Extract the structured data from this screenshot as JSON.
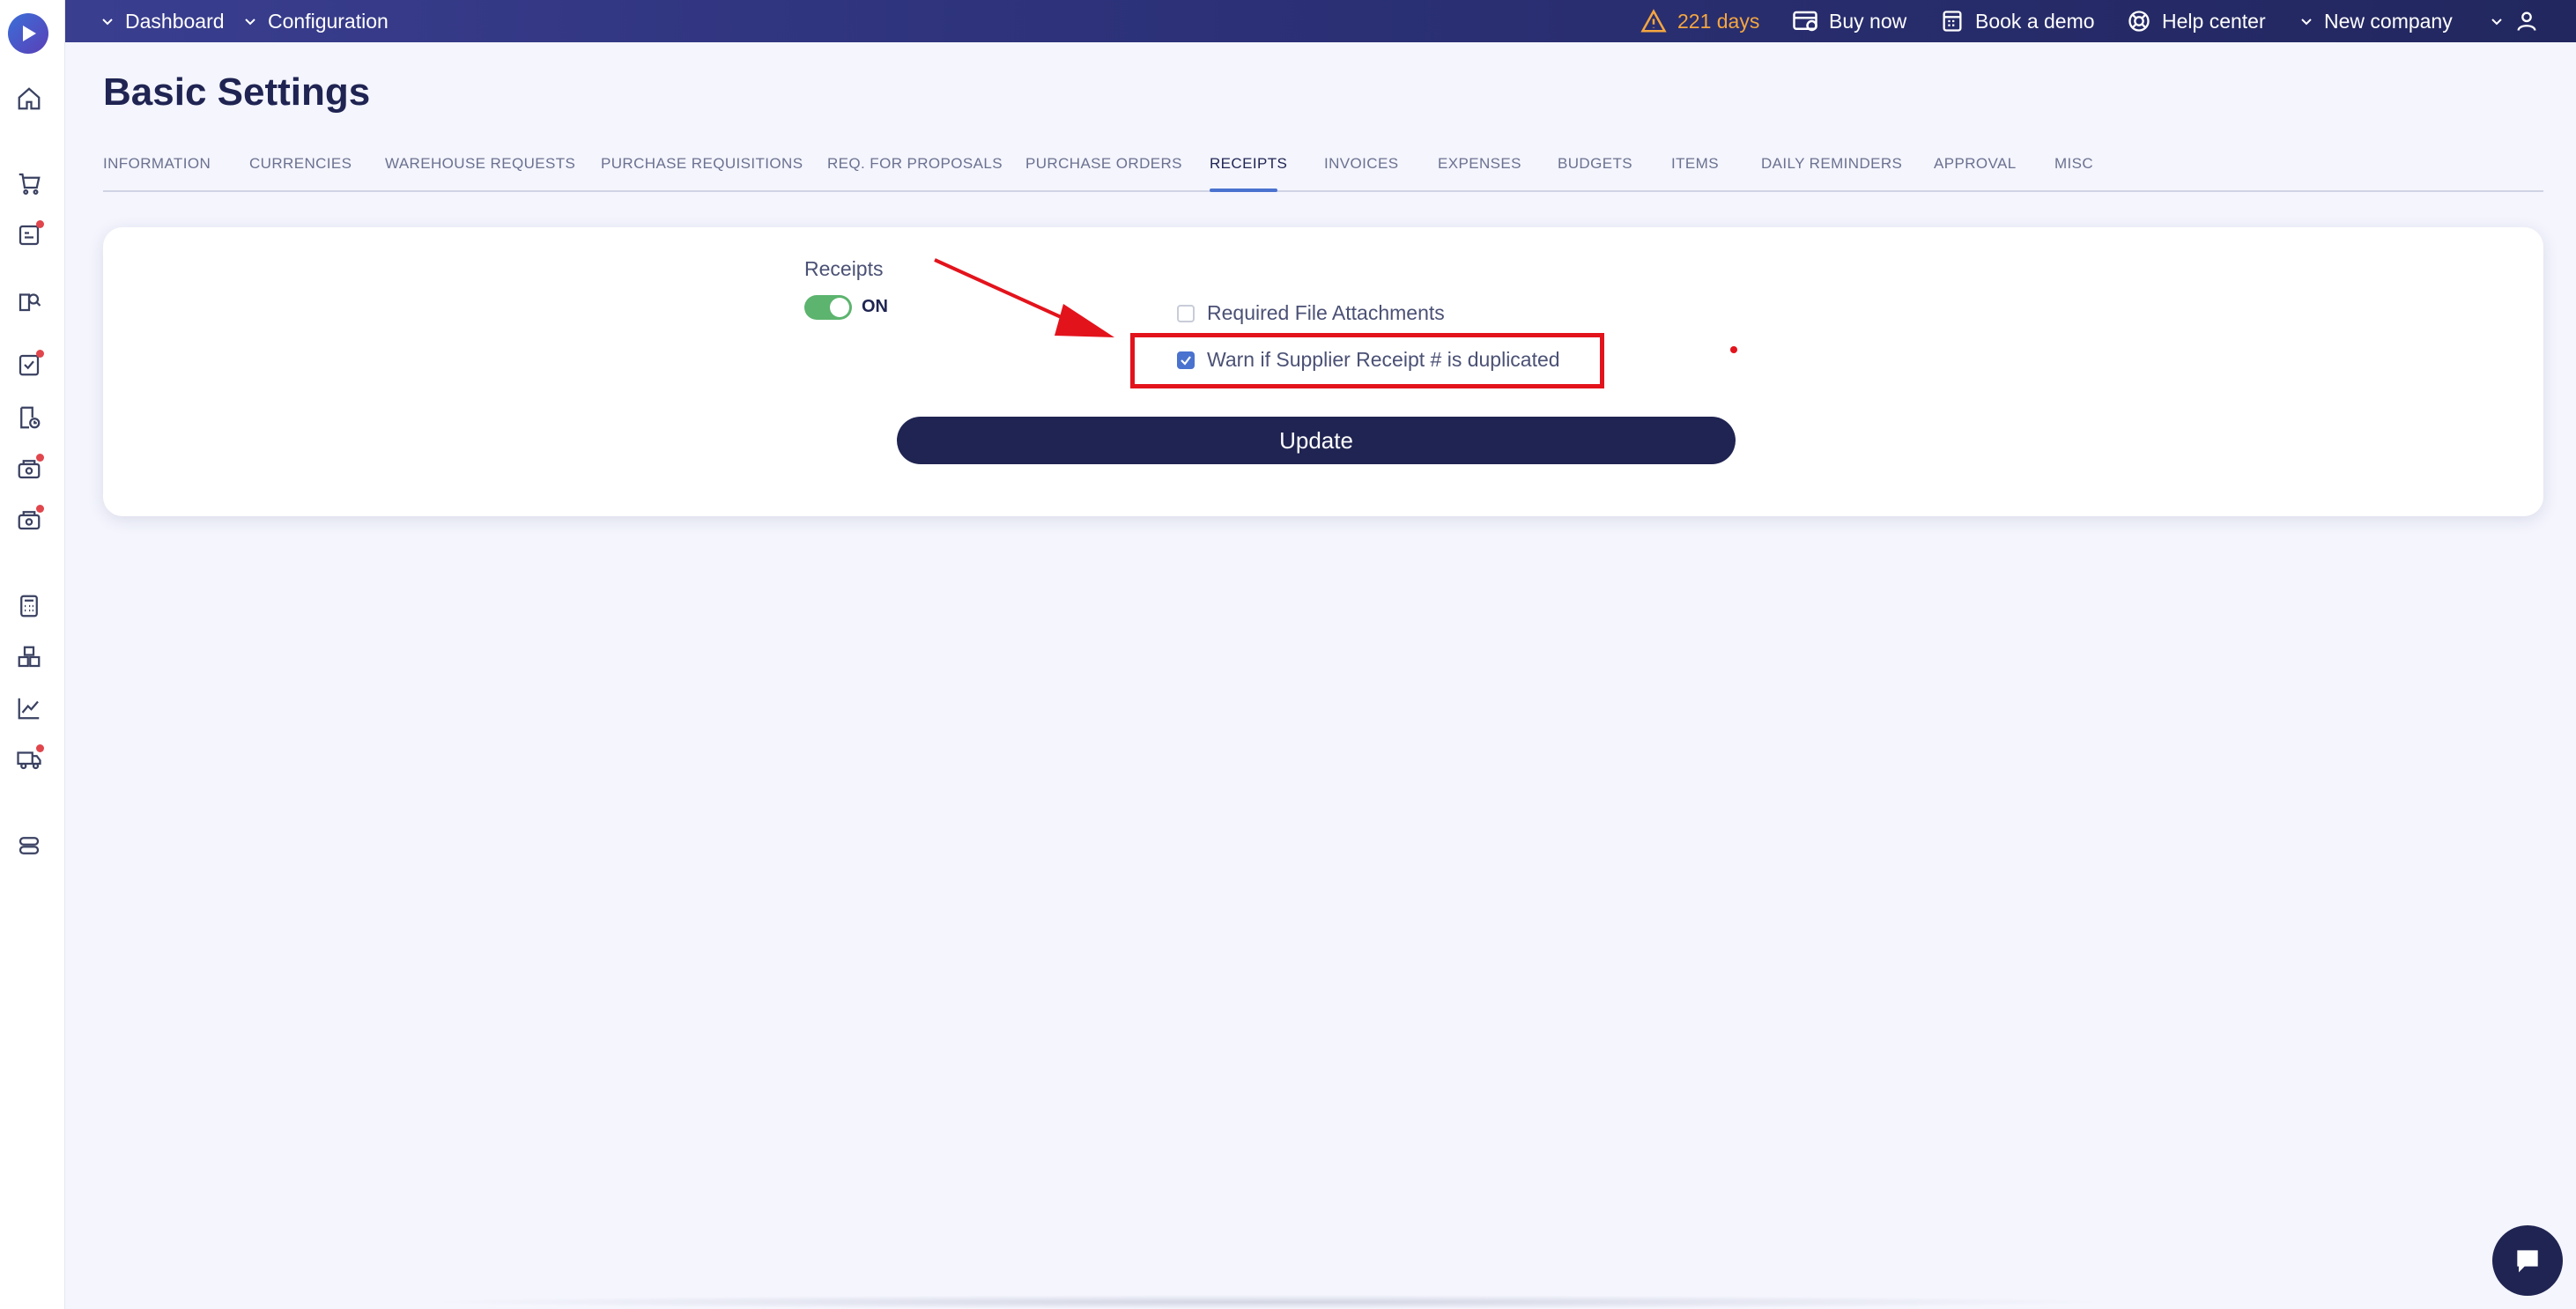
{
  "topbar": {
    "dashboard": "Dashboard",
    "configuration": "Configuration",
    "trial": "221 days",
    "buy_now": "Buy now",
    "book_demo": "Book a demo",
    "help_center": "Help center",
    "company": "New company"
  },
  "page": {
    "title": "Basic Settings"
  },
  "tabs": [
    {
      "label": "INFORMATION"
    },
    {
      "label": "CURRENCIES"
    },
    {
      "label": "WAREHOUSE REQUESTS"
    },
    {
      "label": "PURCHASE REQUISITIONS"
    },
    {
      "label": "REQ. FOR PROPOSALS"
    },
    {
      "label": "PURCHASE ORDERS"
    },
    {
      "label": "RECEIPTS"
    },
    {
      "label": "INVOICES"
    },
    {
      "label": "EXPENSES"
    },
    {
      "label": "BUDGETS"
    },
    {
      "label": "ITEMS"
    },
    {
      "label": "DAILY REMINDERS"
    },
    {
      "label": "APPROVAL"
    },
    {
      "label": "MISC"
    }
  ],
  "active_tab": "RECEIPTS",
  "settings": {
    "section_label": "Receipts",
    "toggle_state": "ON",
    "required_attachments": {
      "label": "Required File Attachments",
      "checked": false
    },
    "warn_duplicate": {
      "label": "Warn if Supplier Receipt # is duplicated",
      "checked": true
    },
    "update_label": "Update"
  },
  "colors": {
    "topbar": "#2d327a",
    "accent": "#4a72cf",
    "toggle_on": "#5cb46e",
    "annotation": "#e3131c",
    "warning": "#f4a640"
  },
  "sidebar_icons": [
    "home-icon",
    "cart-icon",
    "requests-icon",
    "search-doc-icon",
    "checklist-icon",
    "doc-clock-icon",
    "money-box-icon",
    "money-box-2-icon",
    "calculator-icon",
    "boxes-icon",
    "chart-icon",
    "truck-icon",
    "settings-icon"
  ]
}
